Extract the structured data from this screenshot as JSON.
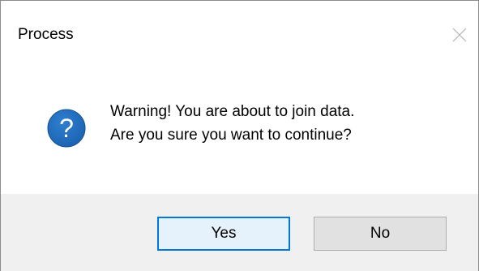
{
  "window": {
    "title": "Process",
    "close_icon": "close-icon"
  },
  "message": {
    "icon": "question-icon",
    "icon_color": "#1b62b0",
    "line1": "Warning! You are about to join data.",
    "line2": "Are you sure you want to continue?"
  },
  "buttons": {
    "yes_label": "Yes",
    "no_label": "No",
    "default_button": "Yes",
    "focus_color": "#0078d7"
  }
}
